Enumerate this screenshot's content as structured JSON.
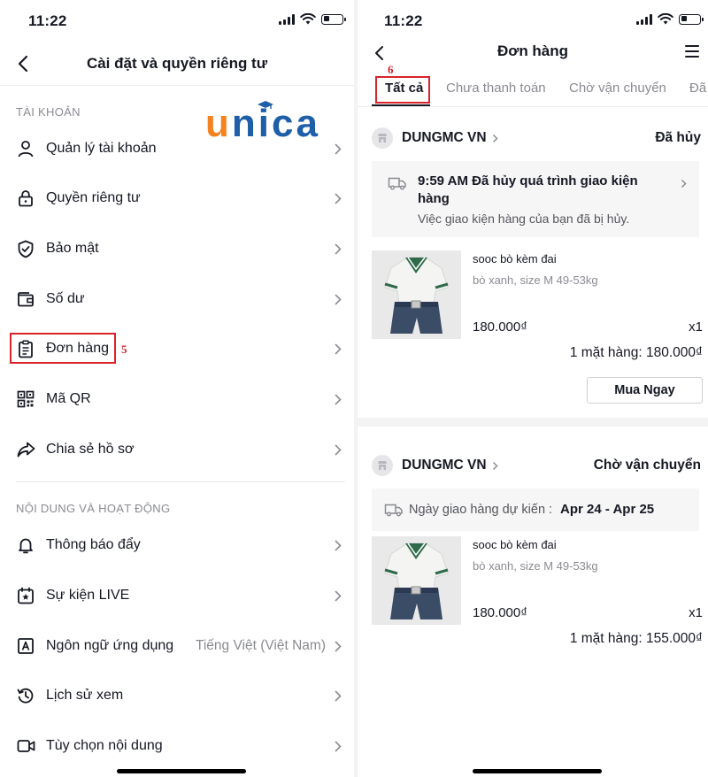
{
  "left_screen": {
    "status_time": "11:22",
    "header": {
      "title": "Cài đặt và quyền riêng tư"
    },
    "brand": {
      "letters": [
        "u",
        "n",
        "i",
        "c",
        "a"
      ],
      "colors": {
        "u": "#f58220",
        "rest": "#1e5fa8"
      }
    },
    "sections": [
      {
        "title": "TÀI KHOẢN",
        "items": [
          {
            "label": "Quản lý tài khoản",
            "icon": "person-icon"
          },
          {
            "label": "Quyền riêng tư",
            "icon": "lock-icon"
          },
          {
            "label": "Bảo mật",
            "icon": "shield-icon"
          },
          {
            "label": "Số dư",
            "icon": "wallet-icon"
          },
          {
            "label": "Đơn hàng",
            "icon": "clipboard-icon"
          },
          {
            "label": "Mã QR",
            "icon": "qr-code-icon"
          },
          {
            "label": "Chia sẻ hồ sơ",
            "icon": "share-icon"
          }
        ]
      },
      {
        "title": "NỘI DUNG VÀ HOẠT ĐỘNG",
        "items": [
          {
            "label": "Thông báo đẩy",
            "icon": "bell-icon"
          },
          {
            "label": "Sự kiện LIVE",
            "icon": "calendar-icon"
          },
          {
            "label": "Ngôn ngữ ứng dụng",
            "icon": "language-icon",
            "value": "Tiếng Việt (Việt Nam)"
          },
          {
            "label": "Lịch sử xem",
            "icon": "history-icon"
          },
          {
            "label": "Tùy chọn nội dung",
            "icon": "video-icon"
          }
        ]
      }
    ],
    "annotation": "5"
  },
  "right_screen": {
    "status_time": "11:22",
    "header": {
      "title": "Đơn hàng"
    },
    "tabs": [
      "Tất cả",
      "Chưa thanh toán",
      "Chờ vận chuyển",
      "Đã"
    ],
    "active_tab": "Tất cả",
    "annotation": "6",
    "orders": [
      {
        "shop": "DUNGMC VN",
        "status": "Đã hủy",
        "tracking": {
          "title": "9:59 AM Đã hủy quá trình giao kiện hàng",
          "subtitle": "Việc giao kiện hàng của bạn đã bị hủy."
        },
        "product": {
          "name": "sooc bò kèm đai",
          "variant": "bò xanh, size M 49-53kg",
          "price": "180.000₫",
          "qty": "x1"
        },
        "total": "1 mặt hàng: 180.000₫",
        "action": "Mua Ngay"
      },
      {
        "shop": "DUNGMC VN",
        "status": "Chờ vận chuyển",
        "delivery": {
          "label": "Ngày giao hàng dự kiến :",
          "range": "Apr 24 - Apr 25"
        },
        "product": {
          "name": "sooc bò kèm đai",
          "variant": "bò xanh, size M 49-53kg",
          "price": "180.000₫",
          "qty": "x1"
        },
        "total": "1 mặt hàng: 155.000₫"
      }
    ]
  },
  "colors": {
    "annotation_red": "#d9232a",
    "text": "#161823",
    "muted": "#8a8b91"
  }
}
